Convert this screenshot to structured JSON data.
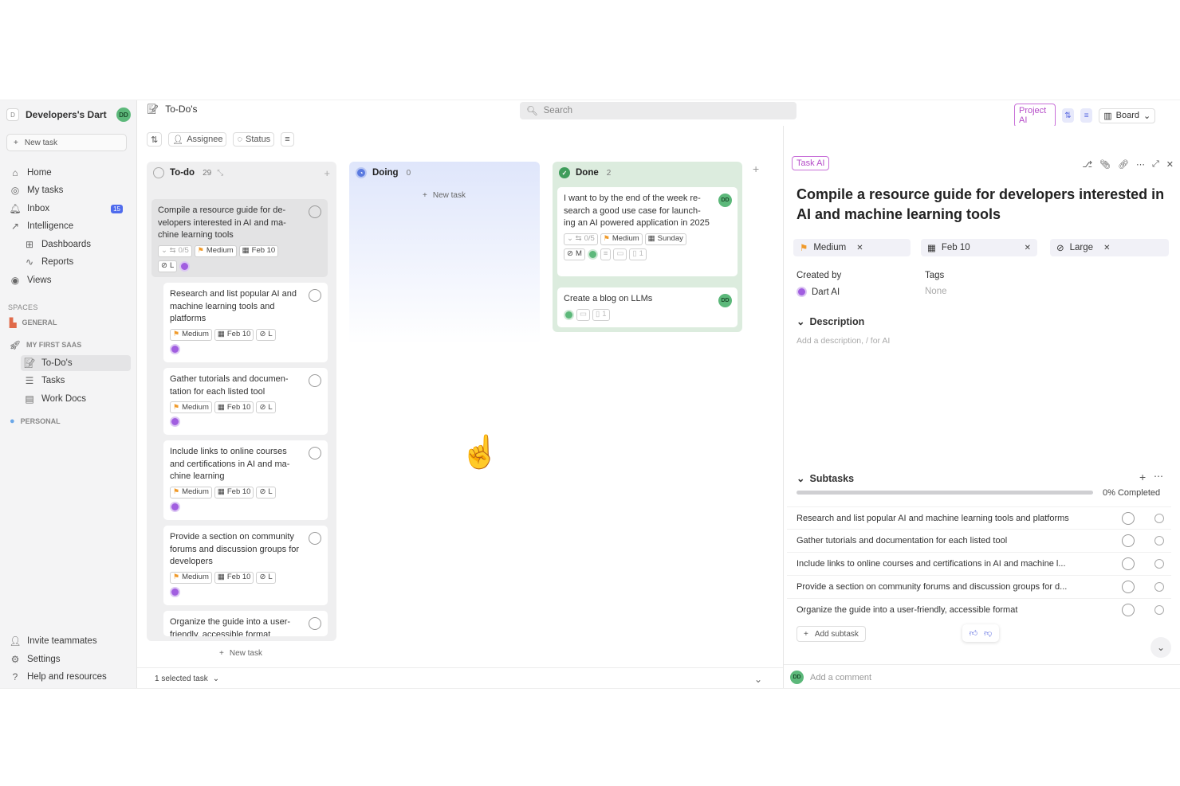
{
  "sidebar": {
    "workspace_logo": "D",
    "workspace_name": "Developers's Dart",
    "user_initials": "DD",
    "new_task": "New task",
    "nav": [
      {
        "label": "Home",
        "icon": "home-icon"
      },
      {
        "label": "My tasks",
        "icon": "target-icon"
      },
      {
        "label": "Inbox",
        "icon": "bell-icon",
        "badge": "15"
      },
      {
        "label": "Intelligence",
        "icon": "chart-icon"
      },
      {
        "label": "Dashboards",
        "icon": "dashboard-icon"
      },
      {
        "label": "Reports",
        "icon": "pulse-icon"
      },
      {
        "label": "Views",
        "icon": "eye-icon"
      }
    ],
    "spaces_label": "SPACES",
    "space_general": "GENERAL",
    "space_saas": "MY FIRST SAAS",
    "saas_items": [
      "To-Do's",
      "Tasks",
      "Work Docs"
    ],
    "space_personal": "PERSONAL",
    "bottom": [
      "Invite teammates",
      "Settings",
      "Help and resources"
    ]
  },
  "header": {
    "crumb": "To-Do's",
    "search_placeholder": "Search",
    "project_ai": "Project AI",
    "board": "Board"
  },
  "toolbar": {
    "assignee": "Assignee",
    "status": "Status"
  },
  "columns": {
    "todo": {
      "title": "To-do",
      "count": "29"
    },
    "doing": {
      "title": "Doing",
      "count": "0",
      "new_task": "New task"
    },
    "done": {
      "title": "Done",
      "count": "2"
    }
  },
  "todo_cards": [
    {
      "title": "Compile a resource guide for de-velopers interested in AI and ma-chine learning tools",
      "priority": "Medium",
      "date": "Feb 10",
      "subtasks": "0/5",
      "size": "L"
    },
    {
      "title": "Research and list popular AI and machine learning tools and platforms",
      "priority": "Medium",
      "date": "Feb 10",
      "size": "L"
    },
    {
      "title": "Gather tutorials and documen-tation for each listed tool",
      "priority": "Medium",
      "date": "Feb 10",
      "size": "L"
    },
    {
      "title": "Include links to online courses and certifications in AI and ma-chine learning",
      "priority": "Medium",
      "date": "Feb 10",
      "size": "L"
    },
    {
      "title": "Provide a section on community forums and discussion groups for developers",
      "priority": "Medium",
      "date": "Feb 10",
      "size": "L"
    },
    {
      "title": "Organize the guide into a user-friendly, accessible format"
    }
  ],
  "todo_new_task": "New task",
  "done_cards": [
    {
      "title": "I want to by the end of the week re-search a good use case for launch-ing an AI powered application in 2025",
      "subtasks": "0/5",
      "priority": "Medium",
      "date": "Sunday",
      "size": "M",
      "doc_count": "1",
      "avatar": "DD"
    },
    {
      "title": "Create a blog on LLMs",
      "doc_count": "1",
      "avatar": "DD"
    }
  ],
  "footer": {
    "selected": "1 selected task"
  },
  "panel": {
    "task_ai": "Task AI",
    "title": "Compile a resource guide for developers interested in AI and machine learning tools",
    "priority": "Medium",
    "date": "Feb 10",
    "size": "Large",
    "created_by_label": "Created by",
    "created_by": "Dart AI",
    "tags_label": "Tags",
    "tags": "None",
    "description_label": "Description",
    "description_placeholder": "Add a description, / for AI",
    "subtasks_label": "Subtasks",
    "progress_pct": 0,
    "completed": "0% Completed",
    "subtasks": [
      "Research and list popular AI and machine learning tools and platforms",
      "Gather tutorials and documentation for each listed tool",
      "Include links to online courses and certifications in AI and machine l...",
      "Provide a section on community forums and discussion groups for d...",
      "Organize the guide into a user-friendly, accessible format"
    ],
    "add_subtask": "Add subtask",
    "comment_placeholder": "Add a comment",
    "comment_avatar": "DD"
  }
}
